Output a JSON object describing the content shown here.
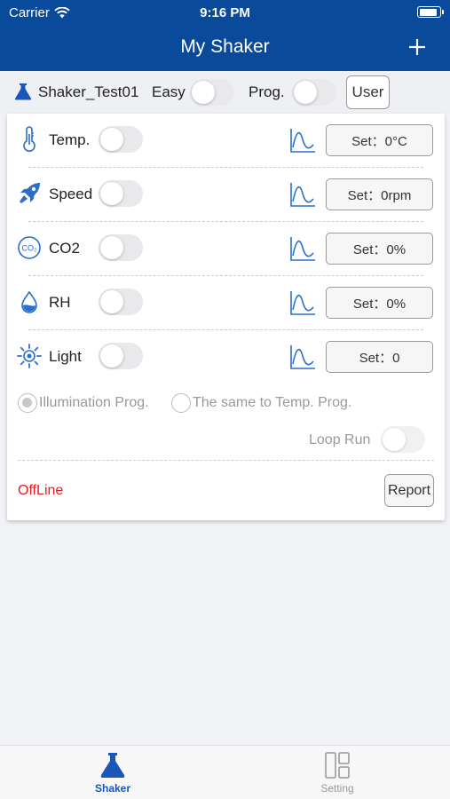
{
  "status_bar": {
    "carrier": "Carrier",
    "time": "9:16 PM"
  },
  "nav": {
    "title": "My Shaker",
    "add_icon": "plus-icon"
  },
  "device": {
    "name": "Shaker_Test01",
    "easy_label": "Easy",
    "easy_on": false,
    "prog_label": "Prog.",
    "prog_on": false,
    "user_button": "User"
  },
  "rows": [
    {
      "icon": "thermometer-icon",
      "label": "Temp.",
      "on": false,
      "set": "Set：0°C"
    },
    {
      "icon": "rocket-icon",
      "label": "Speed",
      "on": false,
      "set": "Set：0rpm"
    },
    {
      "icon": "co2-icon",
      "label": "CO2",
      "on": false,
      "set": "Set：0%"
    },
    {
      "icon": "droplet-icon",
      "label": "RH",
      "on": false,
      "set": "Set：0%"
    },
    {
      "icon": "sun-icon",
      "label": "Light",
      "on": false,
      "set": "Set：0"
    }
  ],
  "radio_options": [
    {
      "label": "Illumination Prog.",
      "checked": true
    },
    {
      "label": "The same to Temp. Prog.",
      "checked": false
    }
  ],
  "loop_run": {
    "label": "Loop Run",
    "on": false
  },
  "status": {
    "text": "OffLine",
    "color": "#e02020"
  },
  "report_button": "Report",
  "tabs": [
    {
      "label": "Shaker",
      "icon": "flask-icon",
      "active": true
    },
    {
      "label": "Setting",
      "icon": "layout-icon",
      "active": false
    }
  ],
  "colors": {
    "brand": "#0a4a9a",
    "icon_blue": "#2a6fc9",
    "tab_active": "#1a56b8"
  }
}
